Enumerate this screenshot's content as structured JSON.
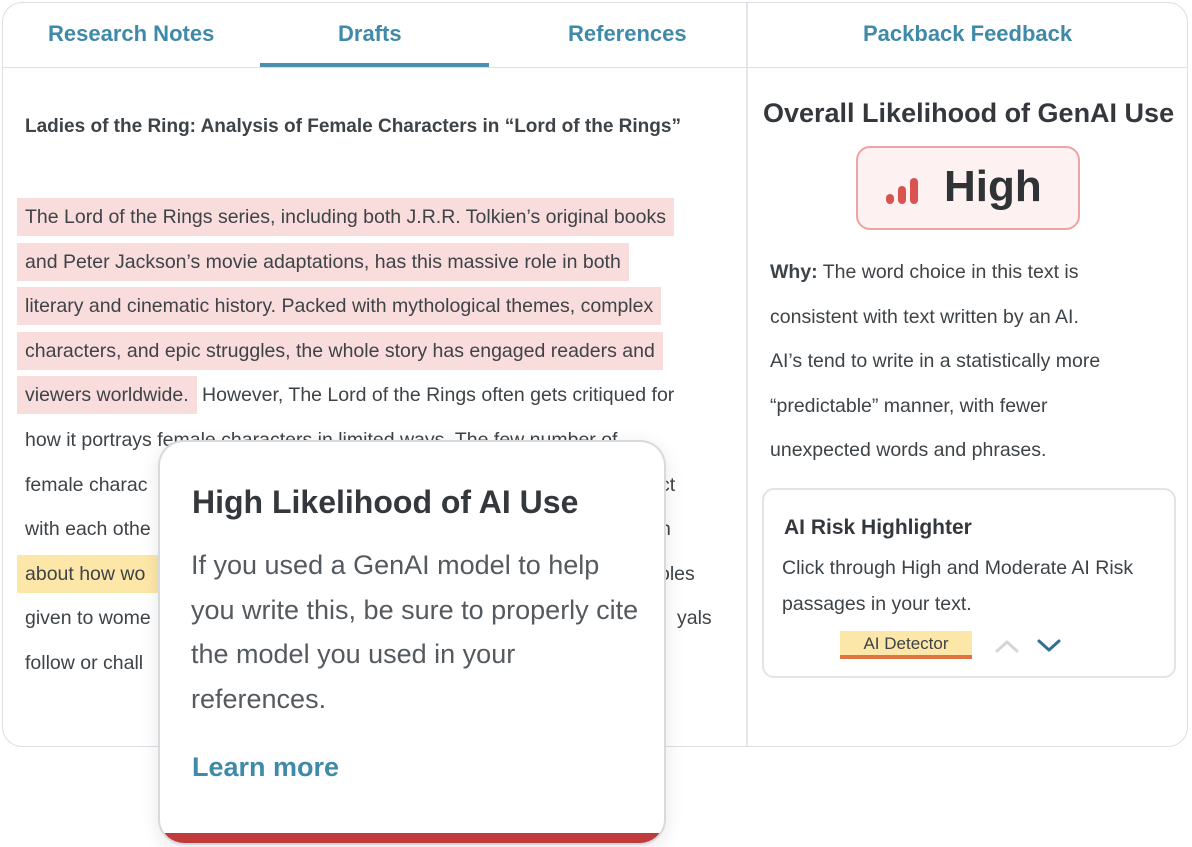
{
  "tabs": {
    "research_notes": "Research Notes",
    "drafts": "Drafts",
    "references": "References",
    "packback_feedback": "Packback Feedback"
  },
  "document": {
    "title": "Ladies of the Ring: Analysis of Female Characters in “Lord of the Rings”",
    "lines": [
      "The Lord of the Rings series, including both J.R.R. Tolkien’s original books",
      "and Peter Jackson’s movie adaptations, has this massive role in both",
      "literary and cinematic history. Packed with mythological themes, complex",
      "characters, and epic struggles, the whole story has engaged readers and",
      "viewers worldwide.",
      " However, The Lord of the Rings often gets critiqued for",
      "how it portrays female characters in limited ways. The few number of",
      "female charac",
      "ct",
      "with each othe",
      "n",
      "about how wo",
      "oles",
      "given to wome",
      "yals",
      "follow or chall"
    ]
  },
  "feedback": {
    "heading": "Overall Likelihood of GenAI Use",
    "level": "High",
    "why_label": "Why:",
    "why_lines": [
      " The word choice in this text is",
      "consistent with text written by an AI.",
      "AI’s tend to write in a statistically more",
      "“predictable” manner, with fewer",
      "unexpected words and phrases."
    ],
    "highlighter": {
      "title": "AI Risk Highlighter",
      "description": "Click through High and Moderate AI Risk passages in your text.",
      "detector_label": "AI Detector",
      "up_icon": "chevron-up-icon",
      "down_icon": "chevron-down-icon"
    }
  },
  "popup": {
    "title": "High Likelihood of AI Use",
    "body": "If you used a GenAI model to help you write this, be sure to properly cite the model you used in your references.",
    "link": "Learn more"
  },
  "colors": {
    "accent": "#3f8aa8",
    "high_risk_highlight": "#f9dcdc",
    "moderate_risk_highlight": "#fde7a8",
    "danger": "#c0393b"
  }
}
